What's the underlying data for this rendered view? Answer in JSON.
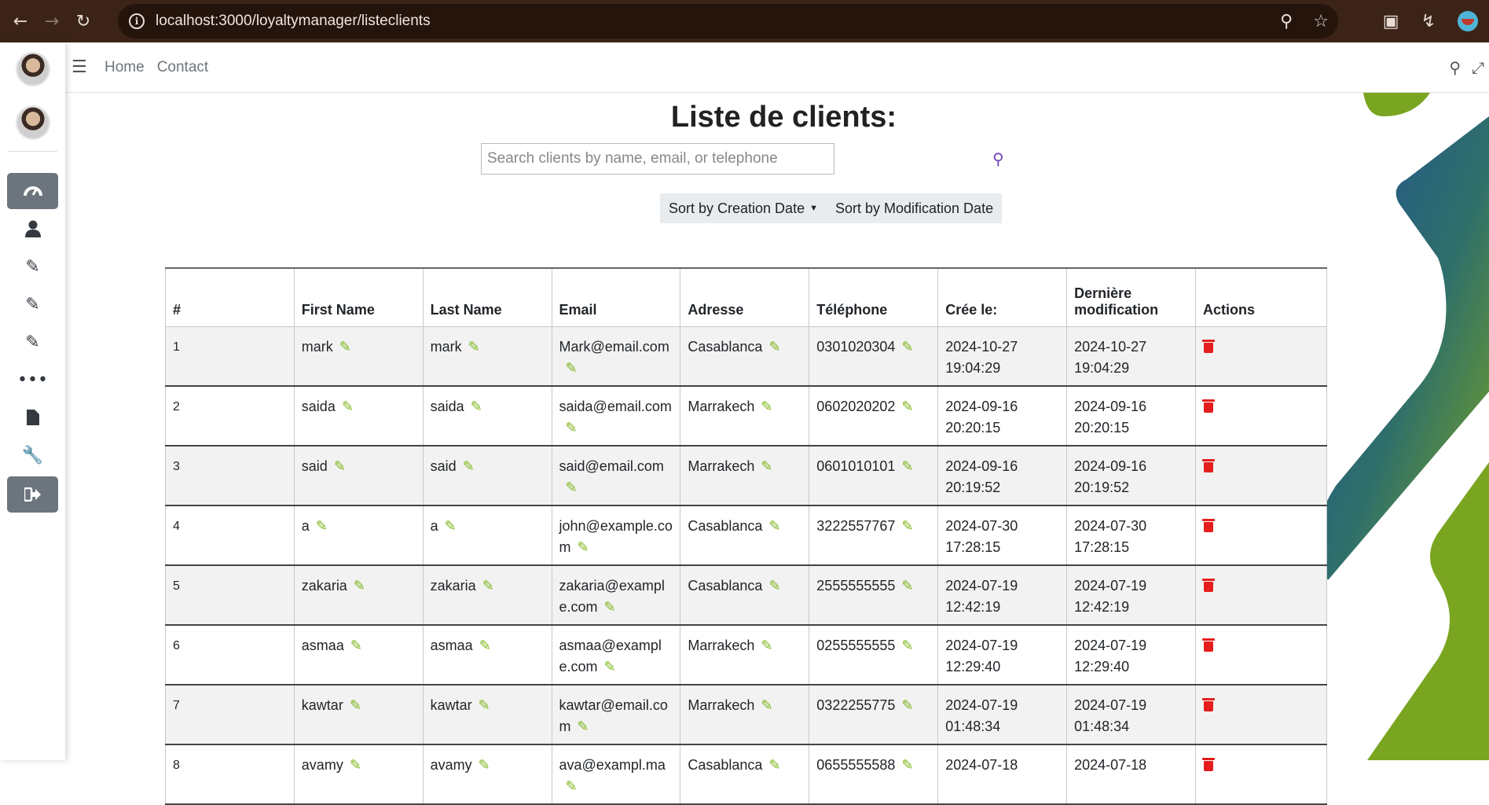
{
  "browser": {
    "url": "localhost:3000/loyaltymanager/listeclients"
  },
  "nav": {
    "links": [
      "Home",
      "Contact"
    ]
  },
  "page": {
    "title": "Liste de clients:",
    "search_placeholder": "Search clients by name, email, or telephone",
    "sort_creation": "Sort by Creation Date",
    "sort_modification": "Sort by Modification Date"
  },
  "sidebar": {
    "items": [
      "dashboard-icon",
      "user-icon",
      "edit-icon",
      "edit-icon",
      "edit-icon",
      "more-icon",
      "file-icon",
      "wrench-icon",
      "logout-icon"
    ]
  },
  "table": {
    "headers": [
      "#",
      "First Name",
      "Last Name",
      "Email",
      "Adresse",
      "Téléphone",
      "Crée le:",
      "Dernière modification",
      "Actions"
    ],
    "rows": [
      {
        "id": "1",
        "first": "mark",
        "last": "mark",
        "email": "Mark@email.com",
        "address": "Casablanca",
        "phone": "0301020304",
        "created_date": "2024-10-27",
        "created_time": "19:04:29",
        "modified_date": "2024-10-27",
        "modified_time": "19:04:29"
      },
      {
        "id": "2",
        "first": "saida",
        "last": "saida",
        "email": "saida@email.com",
        "address": "Marrakech",
        "phone": "0602020202",
        "created_date": "2024-09-16",
        "created_time": "20:20:15",
        "modified_date": "2024-09-16",
        "modified_time": "20:20:15"
      },
      {
        "id": "3",
        "first": "said",
        "last": "said",
        "email": "said@email.com",
        "address": "Marrakech",
        "phone": "0601010101",
        "created_date": "2024-09-16",
        "created_time": "20:19:52",
        "modified_date": "2024-09-16",
        "modified_time": "20:19:52"
      },
      {
        "id": "4",
        "first": "a",
        "last": "a",
        "email": "john@example.com",
        "address": "Casablanca",
        "phone": "3222557767",
        "created_date": "2024-07-30",
        "created_time": "17:28:15",
        "modified_date": "2024-07-30",
        "modified_time": "17:28:15"
      },
      {
        "id": "5",
        "first": "zakaria",
        "last": "zakaria",
        "email": "zakaria@example.com",
        "address": "Casablanca",
        "phone": "2555555555",
        "created_date": "2024-07-19",
        "created_time": "12:42:19",
        "modified_date": "2024-07-19",
        "modified_time": "12:42:19"
      },
      {
        "id": "6",
        "first": "asmaa",
        "last": "asmaa",
        "email": "asmaa@example.com",
        "address": "Marrakech",
        "phone": "0255555555",
        "created_date": "2024-07-19",
        "created_time": "12:29:40",
        "modified_date": "2024-07-19",
        "modified_time": "12:29:40"
      },
      {
        "id": "7",
        "first": "kawtar",
        "last": "kawtar",
        "email": "kawtar@email.com",
        "address": "Marrakech",
        "phone": "0322255775",
        "created_date": "2024-07-19",
        "created_time": "01:48:34",
        "modified_date": "2024-07-19",
        "modified_time": "01:48:34"
      },
      {
        "id": "8",
        "first": "avamy",
        "last": "avamy",
        "email": "ava@exampl.ma",
        "address": "Casablanca",
        "phone": "0655555588",
        "created_date": "2024-07-18",
        "created_time": "",
        "modified_date": "2024-07-18",
        "modified_time": ""
      }
    ]
  },
  "colors": {
    "browser_bar": "#3b2417",
    "edit_icon": "#7cb518",
    "delete_icon": "#e51d1d",
    "search_icon": "#6f42c1",
    "sidebar_active": "#6c757d"
  }
}
